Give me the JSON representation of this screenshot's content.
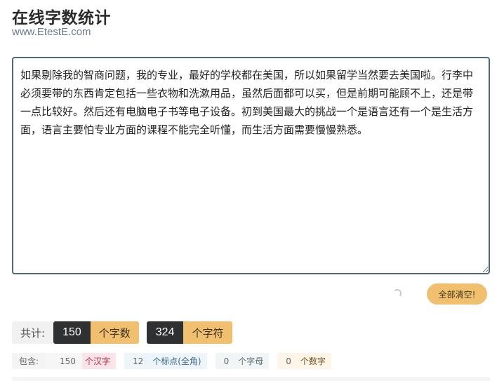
{
  "header": {
    "title": "在线字数统计",
    "subtitle": "www.EtestE.com"
  },
  "editor": {
    "text": "如果剔除我的智商问题，我的专业，最好的学校都在美国，所以如果留学当然要去美国啦。行李中必须要带的东西肯定包括一些衣物和洗漱用品，虽然后面都可以买，但是前期可能顾不上，还是带一点比较好。然后还有电脑电子书等电子设备。初到美国最大的挑战一个是语言还有一个是生活方面，语言主要怕专业方面的课程不能完全听懂，而生活方面需要慢慢熟悉。"
  },
  "actions": {
    "clear_label": "全部清空!"
  },
  "totals": {
    "label": "共计:",
    "words_count": "150",
    "words_unit": "个字数",
    "chars_count": "324",
    "chars_unit": "个字符"
  },
  "details": {
    "label": "包含:",
    "hanzi_count": "150",
    "hanzi_unit": "个汉字",
    "punct_count": "12",
    "punct_unit": "个标点(全角)",
    "letter_count": "0",
    "letter_unit": "个字母",
    "digit_count": "0",
    "digit_unit": "个数字"
  },
  "colors": {
    "accent": "#f1c06f",
    "dark": "#2f3031",
    "border": "#4c6a78"
  }
}
